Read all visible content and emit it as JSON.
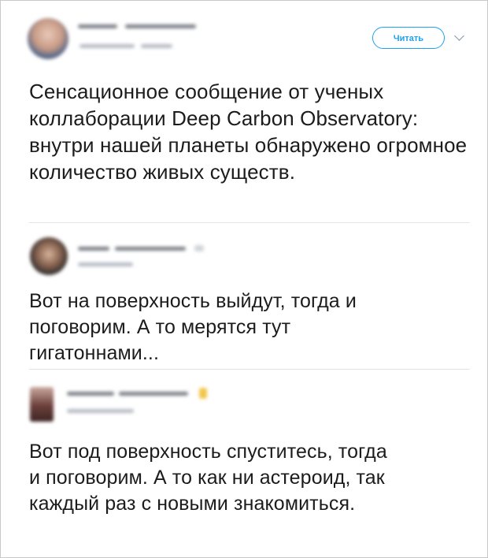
{
  "tweet1": {
    "follow_label": "Читать",
    "text": "Сенсационное сообщение от ученых коллаборации Deep Carbon Observatory: внутри нашей планеты обнаружено огромное количество живых существ."
  },
  "tweet2": {
    "text": "Вот на поверхность выйдут, тогда и поговорим. А то мерятся тут гигатоннами..."
  },
  "tweet3": {
    "text": "Вот под поверхность спуститесь, тогда и поговорим. А то как ни астероид, так каждый раз с новыми знакомиться."
  },
  "colors": {
    "accent": "#1da1f2",
    "text": "#1c1c1c",
    "divider": "#e1e4e8"
  },
  "icons": {
    "menu": "chevron-down-icon",
    "badge": "verified-badge-icon"
  }
}
